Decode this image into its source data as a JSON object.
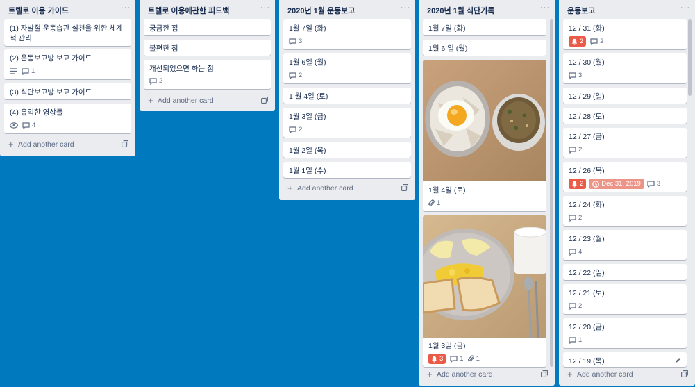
{
  "lists": [
    {
      "title": "트렐로 이용 가이드",
      "cards": [
        {
          "title": "(1) 자발절 운동습관 실천을 위한 체계적 관리"
        },
        {
          "title": "(2) 운동보고방 보고 가이드",
          "comments": "1"
        },
        {
          "title": "(3) 식단보고방 보고 가이드"
        },
        {
          "title": "(4) 유익한 영상들",
          "comments": "4"
        }
      ],
      "add_label": "Add another card"
    },
    {
      "title": "트렐로 이용에관한 피드백",
      "cards": [
        {
          "title": "궁금한 점"
        },
        {
          "title": "불편한 점"
        },
        {
          "title": "개선되었으면 하는 점",
          "comments": "2"
        }
      ],
      "add_label": "Add another card"
    },
    {
      "title": "2020년 1월 운동보고",
      "cards": [
        {
          "title": "1월 7일 (화)",
          "comments": "3"
        },
        {
          "title": "1월 6일 (월)",
          "comments": "2"
        },
        {
          "title": "1 월 4일 (토)"
        },
        {
          "title": "1월 3일 (금)",
          "comments": "2"
        },
        {
          "title": "1월 2일 (목)"
        },
        {
          "title": "1월 1일 (수)"
        }
      ],
      "add_label": "Add another card"
    },
    {
      "title": "2020년 1월 식단기록",
      "cards": [
        {
          "title": "1월 7일 (화)"
        },
        {
          "title": "1월 6 일 (월)"
        },
        {
          "title": "1월 4일 (토)",
          "attachments": "1"
        },
        {
          "title": "1월 3일 (금)",
          "notifications": "3",
          "comments": "1",
          "attachments": "1"
        }
      ],
      "add_label": "Add another card"
    },
    {
      "title": "운동보고",
      "cards": [
        {
          "title": "12 / 31 (화)",
          "notifications": "2",
          "comments": "2"
        },
        {
          "title": "12 / 30 (월)",
          "comments": "3"
        },
        {
          "title": "12 / 29 (일)"
        },
        {
          "title": "12 / 28 (토)"
        },
        {
          "title": "12 / 27 (금)",
          "comments": "2"
        },
        {
          "title": "12 / 26 (목)",
          "notifications": "2",
          "due": "Dec 31, 2019",
          "comments": "3"
        },
        {
          "title": "12 / 24 (화)",
          "comments": "2"
        },
        {
          "title": "12 / 23 (월)",
          "comments": "4"
        },
        {
          "title": "12 / 22 (일)"
        },
        {
          "title": "12 / 21 (토)",
          "comments": "2"
        },
        {
          "title": "12 / 20 (금)",
          "comments": "1"
        },
        {
          "title": "12 / 19 (목)"
        }
      ],
      "add_label": "Add another card"
    }
  ],
  "colors": {
    "board_bg": "#0079bf",
    "list_bg": "#ebecf0",
    "notification_red": "#eb5a46",
    "due_overdue": "#ec9488"
  },
  "menu_glyph": "···",
  "plus_glyph": "+"
}
